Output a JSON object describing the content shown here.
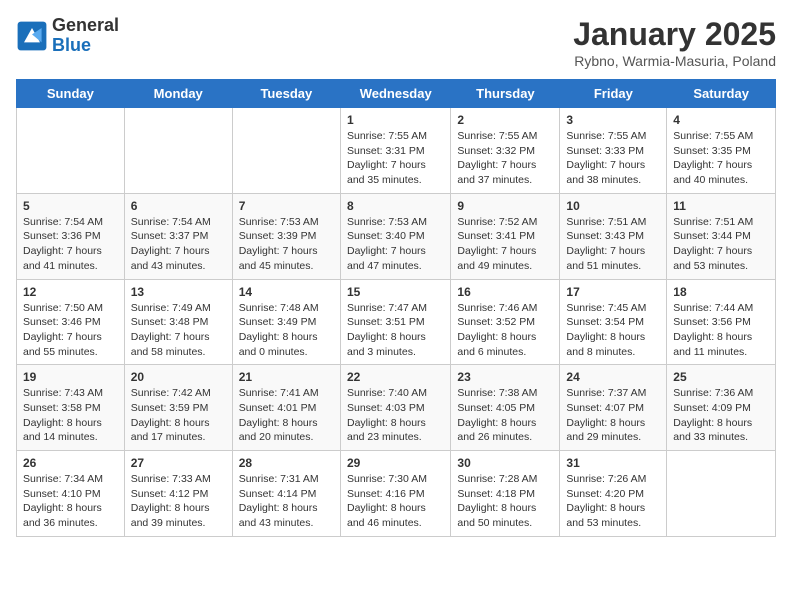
{
  "logo": {
    "general": "General",
    "blue": "Blue"
  },
  "title": "January 2025",
  "location": "Rybno, Warmia-Masuria, Poland",
  "days_of_week": [
    "Sunday",
    "Monday",
    "Tuesday",
    "Wednesday",
    "Thursday",
    "Friday",
    "Saturday"
  ],
  "weeks": [
    [
      {
        "day": "",
        "sunrise": "",
        "sunset": "",
        "daylight": ""
      },
      {
        "day": "",
        "sunrise": "",
        "sunset": "",
        "daylight": ""
      },
      {
        "day": "",
        "sunrise": "",
        "sunset": "",
        "daylight": ""
      },
      {
        "day": "1",
        "sunrise": "Sunrise: 7:55 AM",
        "sunset": "Sunset: 3:31 PM",
        "daylight": "Daylight: 7 hours and 35 minutes."
      },
      {
        "day": "2",
        "sunrise": "Sunrise: 7:55 AM",
        "sunset": "Sunset: 3:32 PM",
        "daylight": "Daylight: 7 hours and 37 minutes."
      },
      {
        "day": "3",
        "sunrise": "Sunrise: 7:55 AM",
        "sunset": "Sunset: 3:33 PM",
        "daylight": "Daylight: 7 hours and 38 minutes."
      },
      {
        "day": "4",
        "sunrise": "Sunrise: 7:55 AM",
        "sunset": "Sunset: 3:35 PM",
        "daylight": "Daylight: 7 hours and 40 minutes."
      }
    ],
    [
      {
        "day": "5",
        "sunrise": "Sunrise: 7:54 AM",
        "sunset": "Sunset: 3:36 PM",
        "daylight": "Daylight: 7 hours and 41 minutes."
      },
      {
        "day": "6",
        "sunrise": "Sunrise: 7:54 AM",
        "sunset": "Sunset: 3:37 PM",
        "daylight": "Daylight: 7 hours and 43 minutes."
      },
      {
        "day": "7",
        "sunrise": "Sunrise: 7:53 AM",
        "sunset": "Sunset: 3:39 PM",
        "daylight": "Daylight: 7 hours and 45 minutes."
      },
      {
        "day": "8",
        "sunrise": "Sunrise: 7:53 AM",
        "sunset": "Sunset: 3:40 PM",
        "daylight": "Daylight: 7 hours and 47 minutes."
      },
      {
        "day": "9",
        "sunrise": "Sunrise: 7:52 AM",
        "sunset": "Sunset: 3:41 PM",
        "daylight": "Daylight: 7 hours and 49 minutes."
      },
      {
        "day": "10",
        "sunrise": "Sunrise: 7:51 AM",
        "sunset": "Sunset: 3:43 PM",
        "daylight": "Daylight: 7 hours and 51 minutes."
      },
      {
        "day": "11",
        "sunrise": "Sunrise: 7:51 AM",
        "sunset": "Sunset: 3:44 PM",
        "daylight": "Daylight: 7 hours and 53 minutes."
      }
    ],
    [
      {
        "day": "12",
        "sunrise": "Sunrise: 7:50 AM",
        "sunset": "Sunset: 3:46 PM",
        "daylight": "Daylight: 7 hours and 55 minutes."
      },
      {
        "day": "13",
        "sunrise": "Sunrise: 7:49 AM",
        "sunset": "Sunset: 3:48 PM",
        "daylight": "Daylight: 7 hours and 58 minutes."
      },
      {
        "day": "14",
        "sunrise": "Sunrise: 7:48 AM",
        "sunset": "Sunset: 3:49 PM",
        "daylight": "Daylight: 8 hours and 0 minutes."
      },
      {
        "day": "15",
        "sunrise": "Sunrise: 7:47 AM",
        "sunset": "Sunset: 3:51 PM",
        "daylight": "Daylight: 8 hours and 3 minutes."
      },
      {
        "day": "16",
        "sunrise": "Sunrise: 7:46 AM",
        "sunset": "Sunset: 3:52 PM",
        "daylight": "Daylight: 8 hours and 6 minutes."
      },
      {
        "day": "17",
        "sunrise": "Sunrise: 7:45 AM",
        "sunset": "Sunset: 3:54 PM",
        "daylight": "Daylight: 8 hours and 8 minutes."
      },
      {
        "day": "18",
        "sunrise": "Sunrise: 7:44 AM",
        "sunset": "Sunset: 3:56 PM",
        "daylight": "Daylight: 8 hours and 11 minutes."
      }
    ],
    [
      {
        "day": "19",
        "sunrise": "Sunrise: 7:43 AM",
        "sunset": "Sunset: 3:58 PM",
        "daylight": "Daylight: 8 hours and 14 minutes."
      },
      {
        "day": "20",
        "sunrise": "Sunrise: 7:42 AM",
        "sunset": "Sunset: 3:59 PM",
        "daylight": "Daylight: 8 hours and 17 minutes."
      },
      {
        "day": "21",
        "sunrise": "Sunrise: 7:41 AM",
        "sunset": "Sunset: 4:01 PM",
        "daylight": "Daylight: 8 hours and 20 minutes."
      },
      {
        "day": "22",
        "sunrise": "Sunrise: 7:40 AM",
        "sunset": "Sunset: 4:03 PM",
        "daylight": "Daylight: 8 hours and 23 minutes."
      },
      {
        "day": "23",
        "sunrise": "Sunrise: 7:38 AM",
        "sunset": "Sunset: 4:05 PM",
        "daylight": "Daylight: 8 hours and 26 minutes."
      },
      {
        "day": "24",
        "sunrise": "Sunrise: 7:37 AM",
        "sunset": "Sunset: 4:07 PM",
        "daylight": "Daylight: 8 hours and 29 minutes."
      },
      {
        "day": "25",
        "sunrise": "Sunrise: 7:36 AM",
        "sunset": "Sunset: 4:09 PM",
        "daylight": "Daylight: 8 hours and 33 minutes."
      }
    ],
    [
      {
        "day": "26",
        "sunrise": "Sunrise: 7:34 AM",
        "sunset": "Sunset: 4:10 PM",
        "daylight": "Daylight: 8 hours and 36 minutes."
      },
      {
        "day": "27",
        "sunrise": "Sunrise: 7:33 AM",
        "sunset": "Sunset: 4:12 PM",
        "daylight": "Daylight: 8 hours and 39 minutes."
      },
      {
        "day": "28",
        "sunrise": "Sunrise: 7:31 AM",
        "sunset": "Sunset: 4:14 PM",
        "daylight": "Daylight: 8 hours and 43 minutes."
      },
      {
        "day": "29",
        "sunrise": "Sunrise: 7:30 AM",
        "sunset": "Sunset: 4:16 PM",
        "daylight": "Daylight: 8 hours and 46 minutes."
      },
      {
        "day": "30",
        "sunrise": "Sunrise: 7:28 AM",
        "sunset": "Sunset: 4:18 PM",
        "daylight": "Daylight: 8 hours and 50 minutes."
      },
      {
        "day": "31",
        "sunrise": "Sunrise: 7:26 AM",
        "sunset": "Sunset: 4:20 PM",
        "daylight": "Daylight: 8 hours and 53 minutes."
      },
      {
        "day": "",
        "sunrise": "",
        "sunset": "",
        "daylight": ""
      }
    ]
  ]
}
